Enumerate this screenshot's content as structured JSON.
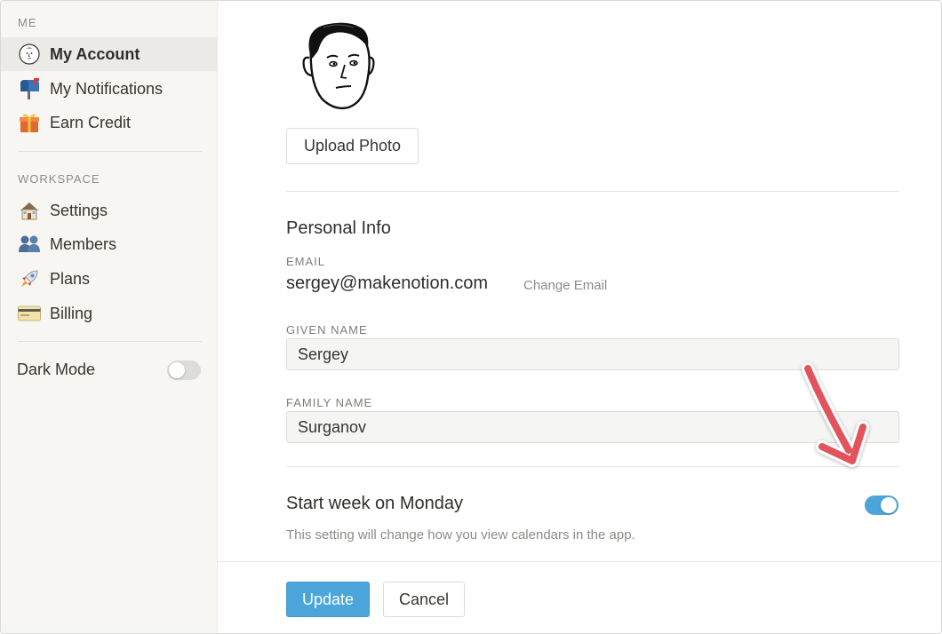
{
  "sidebar": {
    "me_label": "ME",
    "me_items": [
      {
        "label": "My Account",
        "icon": "avatar-face-icon",
        "active": true
      },
      {
        "label": "My Notifications",
        "icon": "mailbox-icon",
        "active": false
      },
      {
        "label": "Earn Credit",
        "icon": "gift-icon",
        "active": false
      }
    ],
    "workspace_label": "WORKSPACE",
    "workspace_items": [
      {
        "label": "Settings",
        "icon": "house-icon"
      },
      {
        "label": "Members",
        "icon": "people-icon"
      },
      {
        "label": "Plans",
        "icon": "rocket-icon"
      },
      {
        "label": "Billing",
        "icon": "credit-card-icon"
      }
    ],
    "dark_mode": {
      "label": "Dark Mode",
      "enabled": false
    }
  },
  "main": {
    "upload_photo_label": "Upload Photo",
    "personal_info_heading": "Personal Info",
    "email_label": "EMAIL",
    "email_value": "sergey@makenotion.com",
    "change_email_label": "Change Email",
    "given_name_label": "GIVEN NAME",
    "given_name_value": "Sergey",
    "family_name_label": "FAMILY NAME",
    "family_name_value": "Surganov",
    "start_week": {
      "title": "Start week on Monday",
      "description": "This setting will change how you view calendars in the app.",
      "enabled": true
    }
  },
  "footer": {
    "update_label": "Update",
    "cancel_label": "Cancel"
  },
  "colors": {
    "accent": "#4ba5db",
    "sidebar_bg": "#f7f6f3",
    "active_item_bg": "#ebeae6",
    "annotation_arrow": "#e2525c"
  }
}
